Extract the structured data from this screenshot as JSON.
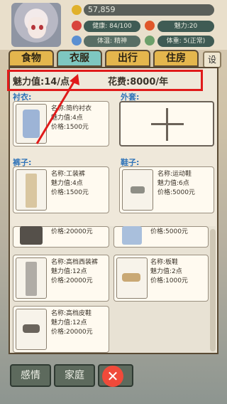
{
  "header": {
    "money": "57,859",
    "health": "健康: 84/100",
    "charm": "魅力:20",
    "bar_left": "体温: 精神",
    "weight": "体重: 5(正常)"
  },
  "tabs": [
    "食物",
    "衣服",
    "出行",
    "住房"
  ],
  "settings_label": "设",
  "summary": {
    "charm": "魅力值:14/点",
    "cost": "花费:8000/年"
  },
  "sections": {
    "shirt": "衬衣:",
    "coat": "外套:",
    "pants": "裤子:",
    "shoes": "鞋子:"
  },
  "items": {
    "shirt": {
      "name": "名称:简约衬衣",
      "charm": "魅力值:4点",
      "price": "价格:1500元"
    },
    "pants": {
      "name": "名称:工装裤",
      "charm": "魅力值:4点",
      "price": "价格:1500元"
    },
    "shoes": {
      "name": "名称:运动鞋",
      "charm": "魅力值:6点",
      "price": "价格:5000元"
    }
  },
  "list": [
    {
      "price": "价格:20000元"
    },
    {
      "price": "价格:5000元"
    },
    {
      "name": "名称:高档西装裤",
      "charm": "魅力值:12点",
      "price": "价格:20000元"
    },
    {
      "name": "名称:板鞋",
      "charm": "魅力值:2点",
      "price": "价格:1000元"
    },
    {
      "name": "名称:高档皮鞋",
      "charm": "魅力值:12点",
      "price": "价格:20000元"
    }
  ],
  "bottom": {
    "b1": "感情",
    "b2": "家庭",
    "b3": "",
    "close": "✕"
  }
}
